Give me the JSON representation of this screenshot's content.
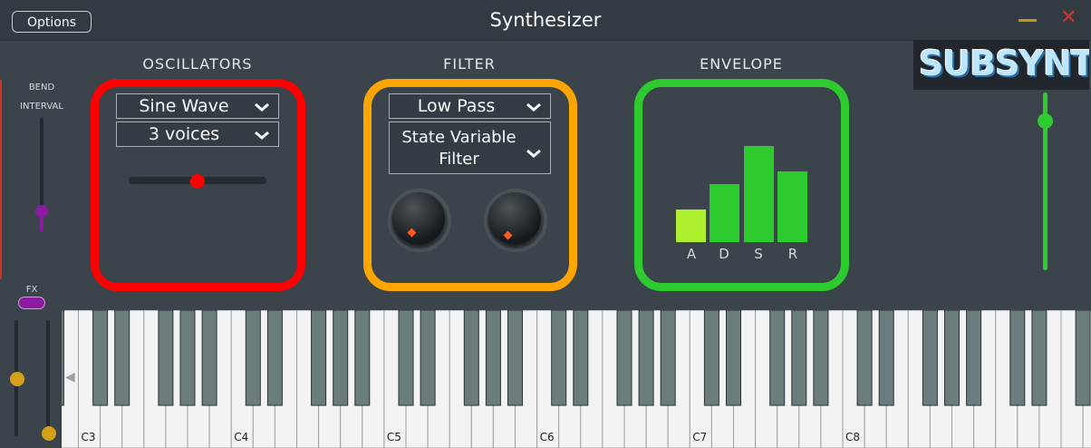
{
  "titlebar": {
    "options_label": "Options",
    "title": "Synthesizer"
  },
  "sidebar": {
    "bend_label": "BEND",
    "interval_label": "INTERVAL",
    "fx_label": "FX"
  },
  "oscillators": {
    "label": "OSCILLATORS",
    "waveform": "Sine Wave",
    "voices": "3 voices",
    "slider_level": 0.5
  },
  "filter": {
    "label": "FILTER",
    "type": "Low Pass",
    "mode": "State Variable Filter"
  },
  "envelope": {
    "label": "ENVELOPE",
    "bars": [
      {
        "label": "A",
        "value": 0.26,
        "color": "#aef02e"
      },
      {
        "label": "D",
        "value": 0.46,
        "color": "#2ecb2e"
      },
      {
        "label": "S",
        "value": 0.76,
        "color": "#2ecb2e"
      },
      {
        "label": "R",
        "value": 0.56,
        "color": "#2ecb2e"
      }
    ]
  },
  "logo": {
    "text": "SUBSYNTH"
  },
  "keyboard": {
    "octave_labels": [
      "C3",
      "C4",
      "C5",
      "C6",
      "C7",
      "C8"
    ]
  },
  "colors": {
    "oscillator_border": "#ff0000",
    "filter_border": "#ffa500",
    "envelope_border": "#2ecb2e"
  }
}
